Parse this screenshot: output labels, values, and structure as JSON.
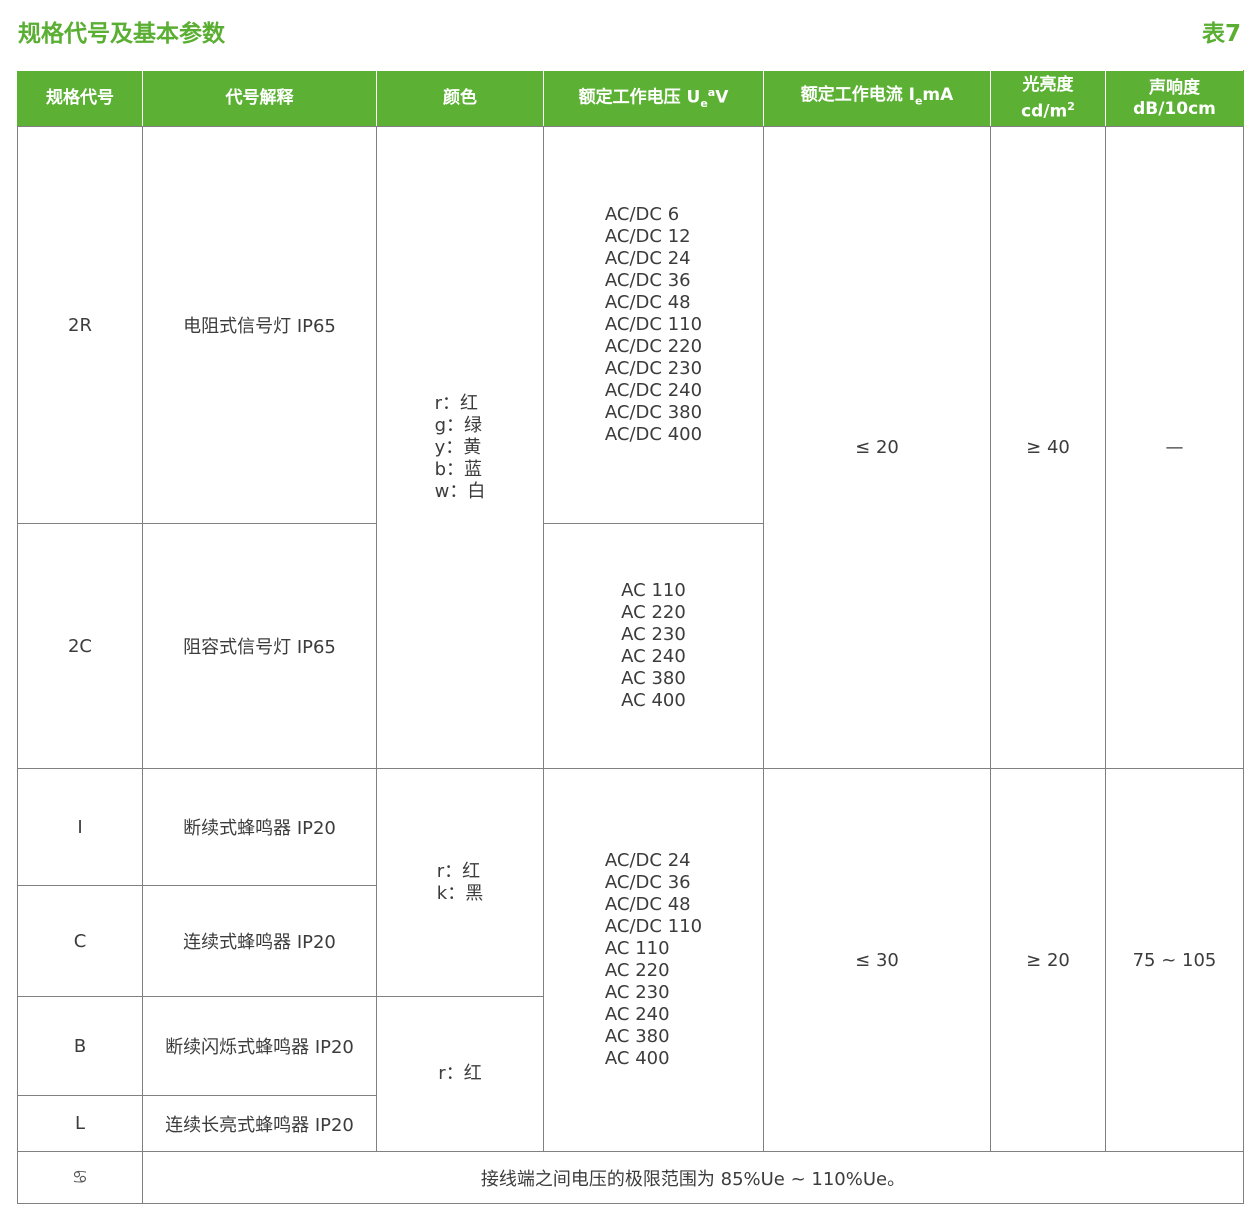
{
  "page": {
    "title": "规格代号及基本参数",
    "table_no": "表7"
  },
  "header": {
    "code": "规格代号",
    "desc": "代号解释",
    "color": "颜色",
    "voltage_prefix": "额定工作电压 U",
    "voltage_sub": "e",
    "voltage_sup": "a",
    "voltage_unit": "V",
    "current_prefix": "额定工作电流 I",
    "current_sub": "e",
    "current_unit": "mA",
    "brightness_line1": "光亮度",
    "brightness_line2": "cd/m",
    "brightness_sup": "2",
    "sound_line1": "声响度",
    "sound_line2": "dB/10cm"
  },
  "rows": {
    "r2R": {
      "code": "2R",
      "desc": "电阻式信号灯 IP65"
    },
    "r2C": {
      "code": "2C",
      "desc": "阻容式信号灯 IP65"
    },
    "rI": {
      "code": "I",
      "desc": "断续式蜂鸣器 IP20"
    },
    "rC": {
      "code": "C",
      "desc": "连续式蜂鸣器 IP20"
    },
    "rB": {
      "code": "B",
      "desc": "断续闪烁式蜂鸣器 IP20"
    },
    "rL": {
      "code": "L",
      "desc": "连续长亮式蜂鸣器 IP20"
    }
  },
  "lamp": {
    "colors": "r：红\ng：绿\ny：黄\nb：蓝\nw：白",
    "voltage_2R": "AC/DC 6\nAC/DC 12\nAC/DC 24\nAC/DC 36\nAC/DC 48\nAC/DC 110\nAC/DC 220\nAC/DC 230\nAC/DC 240\nAC/DC 380\nAC/DC 400",
    "voltage_2C": "AC 110\nAC 220\nAC 230\nAC 240\nAC 380\nAC 400",
    "current": "≤ 20",
    "brightness": "≥ 40",
    "sound": "—"
  },
  "buzzer": {
    "colors_IC": "r：红\nk：黑",
    "colors_BL": "r：红",
    "voltage": "AC/DC 24\nAC/DC 36\nAC/DC 48\nAC/DC 110\nAC 110\nAC 220\nAC 230\nAC 240\nAC 380\nAC 400",
    "current": "≤ 30",
    "brightness": "≥ 20",
    "sound": "75 ~ 105"
  },
  "note": {
    "icon": "note-icon",
    "symbol": "♋",
    "text": "接线端之间电压的极限范围为 85%Ue ~ 110%Ue。"
  },
  "colors": {
    "accent": "#5cb135",
    "title": "#5aae32",
    "border": "#808080"
  }
}
